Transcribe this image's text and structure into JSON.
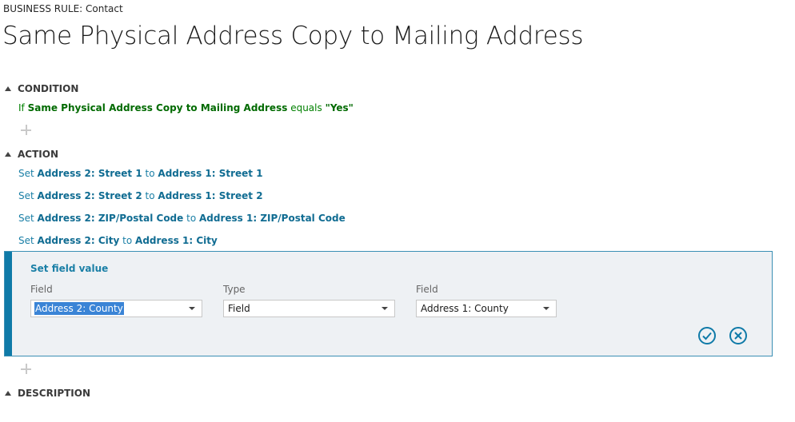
{
  "header": {
    "breadcrumb": "BUSINESS RULE: Contact",
    "title": "Same Physical Address Copy to Mailing Address"
  },
  "condition": {
    "heading": "CONDITION",
    "prefix": "If",
    "field": "Same Physical Address Copy to Mailing Address",
    "operator": "equals",
    "value": "\"Yes\""
  },
  "action": {
    "heading": "ACTION",
    "set_word": "Set",
    "to_word": "to",
    "items": [
      {
        "target": "Address 2: Street 1",
        "source": "Address 1: Street 1"
      },
      {
        "target": "Address 2: Street 2",
        "source": "Address 1: Street 2"
      },
      {
        "target": "Address 2: ZIP/Postal Code",
        "source": "Address 1: ZIP/Postal Code"
      },
      {
        "target": "Address 2: City",
        "source": "Address 1: City"
      }
    ]
  },
  "editor": {
    "title": "Set field value",
    "field_label": "Field",
    "field_value": "Address 2: County",
    "type_label": "Type",
    "type_value": "Field",
    "source_label": "Field",
    "source_value": "Address 1: County"
  },
  "description": {
    "heading": "DESCRIPTION"
  },
  "icons": {
    "confirm": "checkmark-circle-icon",
    "cancel": "x-circle-icon",
    "add": "plus-icon",
    "collapse": "triangle-up-icon"
  },
  "colors": {
    "accent": "#0f7aa8",
    "condition_green": "#008000",
    "action_blue": "#1a7fa6",
    "selection": "#3a84d6"
  }
}
